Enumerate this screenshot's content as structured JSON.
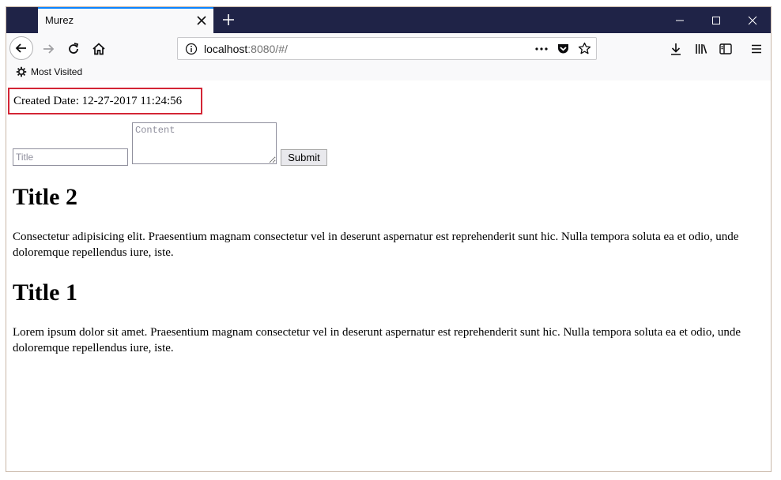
{
  "browser": {
    "tab_title": "Murez",
    "url_host": "localhost",
    "url_rest": ":8080/#/",
    "bookmark_label": "Most Visited",
    "colors": {
      "titlebar": "#1f2347",
      "tab_accent": "#0a84ff",
      "highlight_border": "#d32535"
    }
  },
  "page": {
    "created_date": "Created Date: 12-27-2017 11:24:56",
    "form": {
      "title_placeholder": "Title",
      "content_placeholder": "Content",
      "submit_label": "Submit"
    },
    "posts": [
      {
        "title": "Title 2",
        "body": "Consectetur adipisicing elit. Praesentium magnam consectetur vel in deserunt aspernatur est reprehenderit sunt hic. Nulla tempora soluta ea et odio, unde doloremque repellendus iure, iste."
      },
      {
        "title": "Title 1",
        "body": "Lorem ipsum dolor sit amet. Praesentium magnam consectetur vel in deserunt aspernatur est reprehenderit sunt hic. Nulla tempora soluta ea et odio, unde doloremque repellendus iure, iste."
      }
    ]
  }
}
